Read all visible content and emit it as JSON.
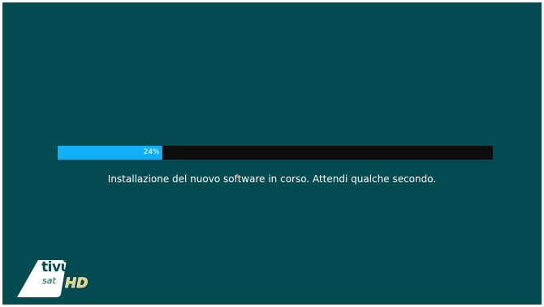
{
  "progress": {
    "value": 24,
    "label": "24%",
    "fill_color": "#0fb0f5",
    "track_color": "#0d0d0d"
  },
  "status": {
    "message": "Installazione del nuovo software in corso. Attendi qualche secondo."
  },
  "logo": {
    "brand": "tivù",
    "sub": "sat",
    "hd": "HD"
  },
  "colors": {
    "background": "#024b50",
    "text": "#ffffff",
    "hd_accent": "#e7cf6a"
  }
}
